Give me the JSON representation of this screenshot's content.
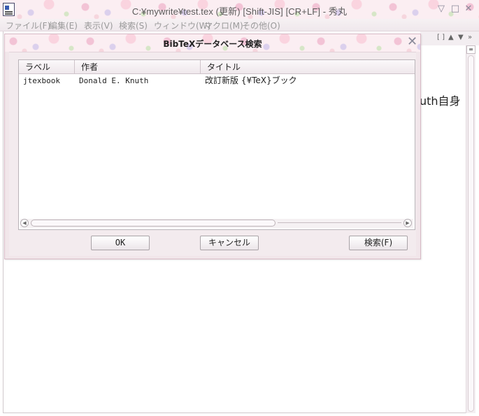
{
  "window": {
    "title": "C:¥mywrite¥test.tex (更新) [Shift-JIS] [CR+LF] - 秀丸",
    "controls": [
      "▽",
      "□",
      "✕"
    ]
  },
  "menu": {
    "items": [
      "ファイル(F)",
      "編集(E)",
      "表示(V)",
      "検索(S)",
      "ウィンドウ(W)",
      "マクロ(M)",
      "その他(O)"
    ]
  },
  "toolstrip": {
    "icons": [
      "[ ]",
      "▲",
      "▼",
      "»"
    ]
  },
  "editor": {
    "visible_text": "uth自身"
  },
  "dialog": {
    "title": "BibTeXデータベース検索",
    "close_glyph": "✕",
    "columns": [
      "ラベル",
      "作者",
      "タイトル"
    ],
    "rows": [
      {
        "label": "jtexbook",
        "author": "Donald E. Knuth",
        "title": "改訂新版 {¥TeX}ブック"
      }
    ],
    "buttons": {
      "ok": "OK",
      "cancel": "キャンセル",
      "search": "検索(F)"
    }
  },
  "scrollbar_glyphs": {
    "left": "◀",
    "right": "▶",
    "up": "≡"
  }
}
